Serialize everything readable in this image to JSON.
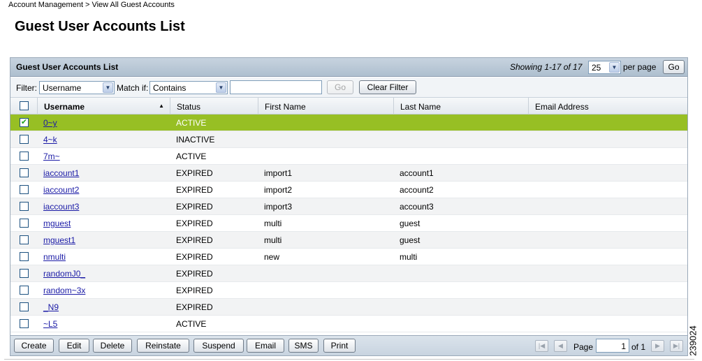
{
  "breadcrumb": {
    "items": [
      "Account Management",
      "View All Guest Accounts"
    ],
    "separator": ">"
  },
  "page_title": "Guest User Accounts List",
  "panel": {
    "title": "Guest User Accounts List",
    "showing": "Showing 1-17 of 17",
    "per_page_value": "25",
    "per_page_label": "per page",
    "go_label": "Go"
  },
  "filter": {
    "filter_label": "Filter:",
    "field_value": "Username",
    "match_label": "Match if:",
    "match_value": "Contains",
    "input_value": "",
    "go_label": "Go",
    "clear_label": "Clear Filter"
  },
  "columns": [
    "Username",
    "Status",
    "First Name",
    "Last Name",
    "Email Address"
  ],
  "sorted_column": "Username",
  "rows": [
    {
      "username": "0~y",
      "status": "ACTIVE",
      "first": "",
      "last": "",
      "email": "",
      "checked": true
    },
    {
      "username": "4~k",
      "status": "INACTIVE",
      "first": "",
      "last": "",
      "email": "",
      "checked": false
    },
    {
      "username": "7m~",
      "status": "ACTIVE",
      "first": "",
      "last": "",
      "email": "",
      "checked": false
    },
    {
      "username": "iaccount1",
      "status": "EXPIRED",
      "first": "import1",
      "last": "account1",
      "email": "",
      "checked": false
    },
    {
      "username": "iaccount2",
      "status": "EXPIRED",
      "first": "import2",
      "last": "account2",
      "email": "",
      "checked": false
    },
    {
      "username": "iaccount3",
      "status": "EXPIRED",
      "first": "import3",
      "last": "account3",
      "email": "",
      "checked": false
    },
    {
      "username": "mguest",
      "status": "EXPIRED",
      "first": "multi",
      "last": "guest",
      "email": "",
      "checked": false
    },
    {
      "username": "mguest1",
      "status": "EXPIRED",
      "first": "multi",
      "last": "guest",
      "email": "",
      "checked": false
    },
    {
      "username": "nmulti",
      "status": "EXPIRED",
      "first": "new",
      "last": "multi",
      "email": "",
      "checked": false
    },
    {
      "username": "randomJ0_",
      "status": "EXPIRED",
      "first": "",
      "last": "",
      "email": "",
      "checked": false
    },
    {
      "username": "random~3x",
      "status": "EXPIRED",
      "first": "",
      "last": "",
      "email": "",
      "checked": false
    },
    {
      "username": "_N9",
      "status": "EXPIRED",
      "first": "",
      "last": "",
      "email": "",
      "checked": false
    },
    {
      "username": "~L5",
      "status": "ACTIVE",
      "first": "",
      "last": "",
      "email": "",
      "checked": false
    }
  ],
  "actions": [
    "Create",
    "Edit",
    "Delete",
    "Reinstate",
    "Suspend",
    "Email",
    "SMS",
    "Print"
  ],
  "pagination": {
    "page_label": "Page",
    "page_value": "1",
    "of_label": "of 1"
  },
  "image_id": "239024",
  "colors": {
    "selected_row": "#97bf24",
    "header": "#b9c8d6",
    "link": "#1a1aa6"
  }
}
